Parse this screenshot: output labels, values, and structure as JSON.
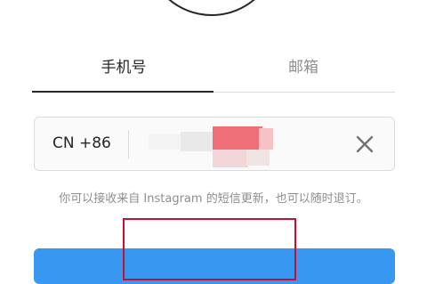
{
  "tabs": [
    {
      "label": "手机号",
      "active": true
    },
    {
      "label": "邮箱",
      "active": false
    }
  ],
  "phone": {
    "country_code": "CN +86",
    "value": ""
  },
  "icons": {
    "clear": "close-icon",
    "avatar": "avatar-outline-icon"
  },
  "notice": "你可以接收来自 Instagram 的短信更新，也可以随时退订。",
  "colors": {
    "primary_button": "#3897f0",
    "highlight": "#c8102e",
    "text": "#262626",
    "muted": "#8e8e8e",
    "border": "#dbdbdb"
  }
}
